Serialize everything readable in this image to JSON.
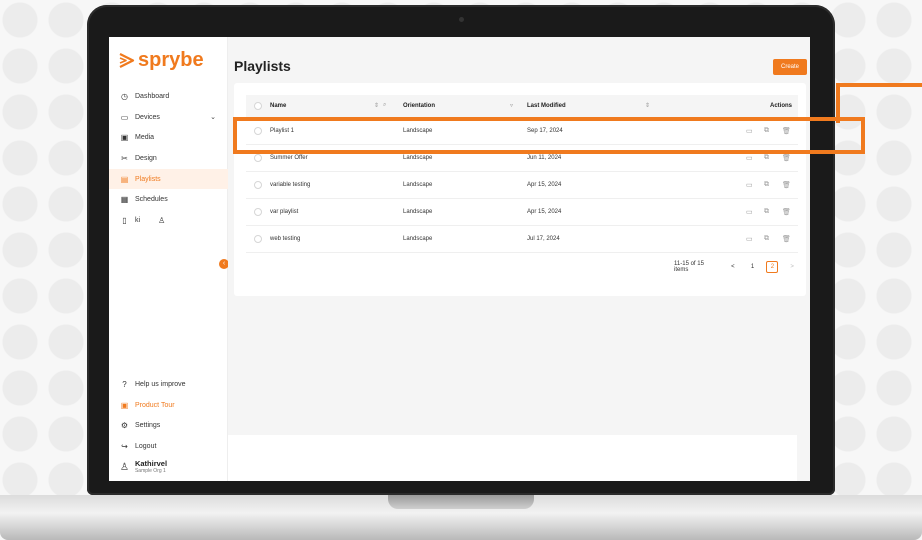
{
  "app": {
    "logo_text": "sprybe",
    "brand_color": "#f07a1e"
  },
  "sidebar": {
    "items": [
      {
        "label": "Dashboard",
        "icon": "dashboard-icon"
      },
      {
        "label": "Devices",
        "icon": "devices-icon",
        "expandable": true
      },
      {
        "label": "Media",
        "icon": "media-icon"
      },
      {
        "label": "Design",
        "icon": "design-icon"
      },
      {
        "label": "Playlists",
        "icon": "playlist-icon",
        "active": true
      },
      {
        "label": "Schedules",
        "icon": "schedules-icon"
      },
      {
        "label": "ki",
        "icon": "doc-icon",
        "extra_icon": "person-icon"
      }
    ],
    "bottom_items": [
      {
        "label": "Help us improve",
        "icon": "help-icon"
      },
      {
        "label": "Product Tour",
        "icon": "tour-icon"
      },
      {
        "label": "Settings",
        "icon": "gear-icon"
      },
      {
        "label": "Logout",
        "icon": "logout-icon"
      }
    ],
    "user": {
      "name": "Kathirvel",
      "org": "Sample Org 1"
    }
  },
  "main": {
    "title": "Playlists",
    "create_label": "Create",
    "table": {
      "headers": {
        "name": "Name",
        "orientation": "Orientation",
        "last_modified": "Last Modified",
        "actions": "Actions"
      },
      "rows": [
        {
          "name": "Playlist 1",
          "orientation": "Landscape",
          "last_modified": "Sep 17, 2024"
        },
        {
          "name": "Summer Offer",
          "orientation": "Landscape",
          "last_modified": "Jun 11, 2024"
        },
        {
          "name": "variable testing",
          "orientation": "Landscape",
          "last_modified": "Apr 15, 2024"
        },
        {
          "name": "var playlist",
          "orientation": "Landscape",
          "last_modified": "Apr 15, 2024"
        },
        {
          "name": "web testing",
          "orientation": "Landscape",
          "last_modified": "Jul 17, 2024"
        }
      ]
    },
    "pagination": {
      "summary": "11-15 of 15 items",
      "pages": [
        "1",
        "2"
      ],
      "current": "2",
      "prev": "<",
      "next": ">"
    }
  }
}
